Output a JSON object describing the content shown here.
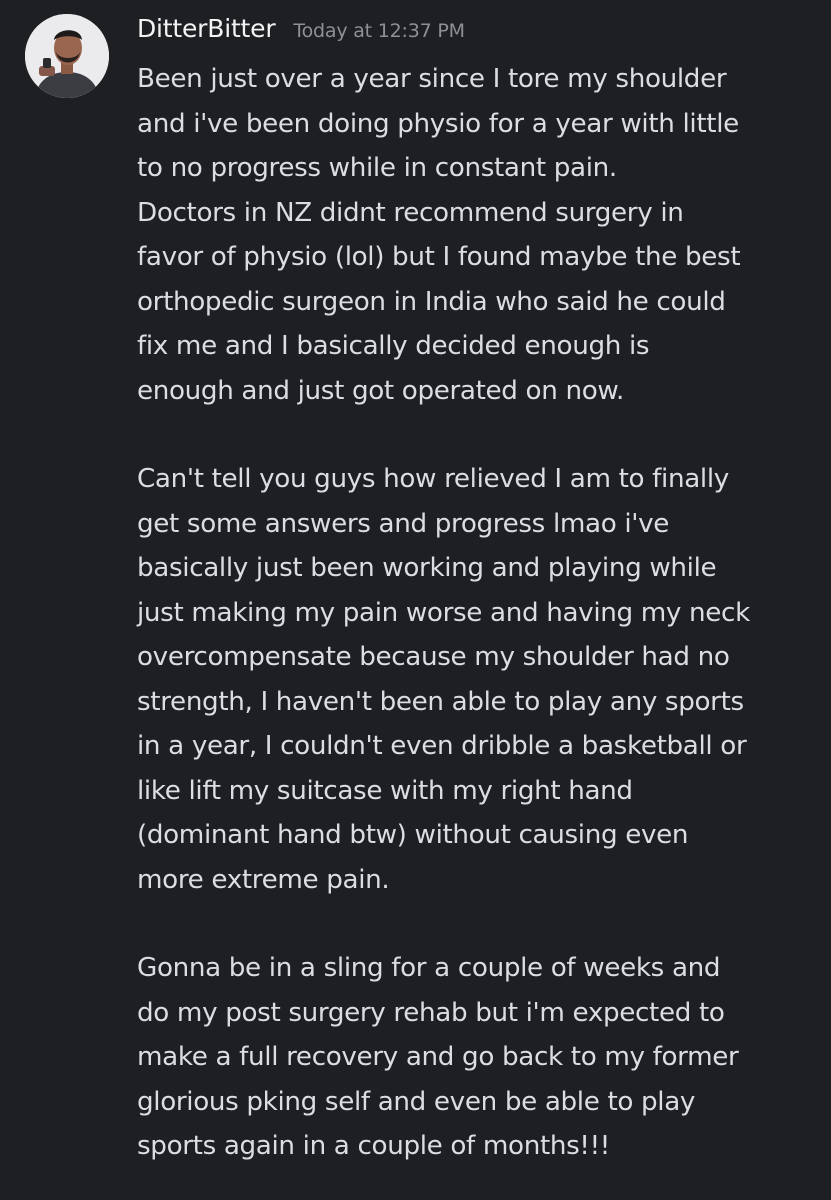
{
  "message": {
    "username": "DitterBitter",
    "timestamp": "Today at 12:37 PM",
    "paragraphs": [
      {
        "lines": [
          "Been just over a year since I tore my shoulder",
          "and i've been doing physio for a year with little",
          "to no progress while in constant pain.",
          "Doctors in NZ didnt recommend surgery in",
          "favor of physio (lol) but I found maybe the best",
          "orthopedic surgeon in India who said he could",
          "fix me and I basically decided enough is",
          "enough and just got operated on now."
        ]
      },
      {
        "lines": [
          "Can't tell you guys how relieved I am to finally",
          "get some answers and progress lmao i've",
          "basically just been working and playing while",
          "just making my pain worse and having my neck",
          "overcompensate because my shoulder had no",
          "strength, I haven't been able to play any sports",
          "in a year, I couldn't even dribble a basketball or",
          "like lift my suitcase with my right hand",
          "(dominant hand btw) without causing even",
          "more extreme pain."
        ]
      },
      {
        "lines": [
          "Gonna be in a sling for a couple of weeks and",
          "do my post surgery rehab but i'm expected to",
          "make a full recovery and go back to my former",
          "glorious pking self and even be able to play",
          "sports again in a couple of months!!!"
        ]
      }
    ]
  }
}
